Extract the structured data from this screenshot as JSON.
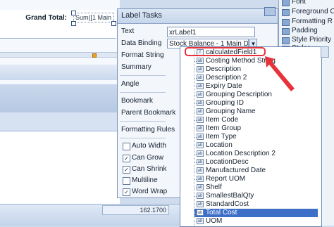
{
  "designer": {
    "grand_total_label": "Grand Total:",
    "sum_cell_text": "Sum([1 Main D"
  },
  "properties": {
    "items": [
      "Font",
      "Foreground C",
      "Formatting R",
      "Padding",
      "Style Priority",
      "Styles"
    ]
  },
  "status": {
    "value": "162.1700"
  },
  "label_tasks": {
    "title": "Label Tasks",
    "text_label": "Text",
    "text_value": "xrLabel1",
    "binding_label": "Data Binding",
    "binding_value": "Stock Balance - 1 Main D",
    "format_string": "Format String",
    "summary": "Summary",
    "angle": "Angle",
    "bookmark": "Bookmark",
    "parent_bookmark": "Parent Bookmark",
    "formatting_rules": "Formatting Rules",
    "options": [
      {
        "label": "Auto Width",
        "checked": false
      },
      {
        "label": "Can Grow",
        "checked": true
      },
      {
        "label": "Can Shrink",
        "checked": true
      },
      {
        "label": "Multiline",
        "checked": false
      },
      {
        "label": "Word Wrap",
        "checked": true
      }
    ]
  },
  "field_list": {
    "items": [
      {
        "icon": "f",
        "label": "calculatedField1",
        "selected": false
      },
      {
        "icon": "ab",
        "label": "Costing Method String",
        "selected": false
      },
      {
        "icon": "ab",
        "label": "Description",
        "selected": false
      },
      {
        "icon": "ab",
        "label": "Description 2",
        "selected": false
      },
      {
        "icon": "ab",
        "label": "Expiry Date",
        "selected": false
      },
      {
        "icon": "ab",
        "label": "Grouping Description",
        "selected": false
      },
      {
        "icon": "ab",
        "label": "Grouping ID",
        "selected": false
      },
      {
        "icon": "ab",
        "label": "Grouping Name",
        "selected": false
      },
      {
        "icon": "ab",
        "label": "Item Code",
        "selected": false
      },
      {
        "icon": "ab",
        "label": "Item Group",
        "selected": false
      },
      {
        "icon": "ab",
        "label": "Item Type",
        "selected": false
      },
      {
        "icon": "ab",
        "label": "Location",
        "selected": false
      },
      {
        "icon": "ab",
        "label": "Location Description 2",
        "selected": false
      },
      {
        "icon": "ab",
        "label": "LocationDesc",
        "selected": false
      },
      {
        "icon": "ab",
        "label": "Manufactured Date",
        "selected": false
      },
      {
        "icon": "ab",
        "label": "Report UOM",
        "selected": false
      },
      {
        "icon": "ab",
        "label": "Shelf",
        "selected": false
      },
      {
        "icon": "ab",
        "label": "SmallestBalQty",
        "selected": false
      },
      {
        "icon": "ab",
        "label": "StandardCost",
        "selected": false
      },
      {
        "icon": "ab",
        "label": "Total Cost",
        "selected": true
      },
      {
        "icon": "ab",
        "label": "UOM",
        "selected": false
      }
    ]
  },
  "colors": {
    "highlight": "#e8323a",
    "selection": "#3d6fc8"
  }
}
